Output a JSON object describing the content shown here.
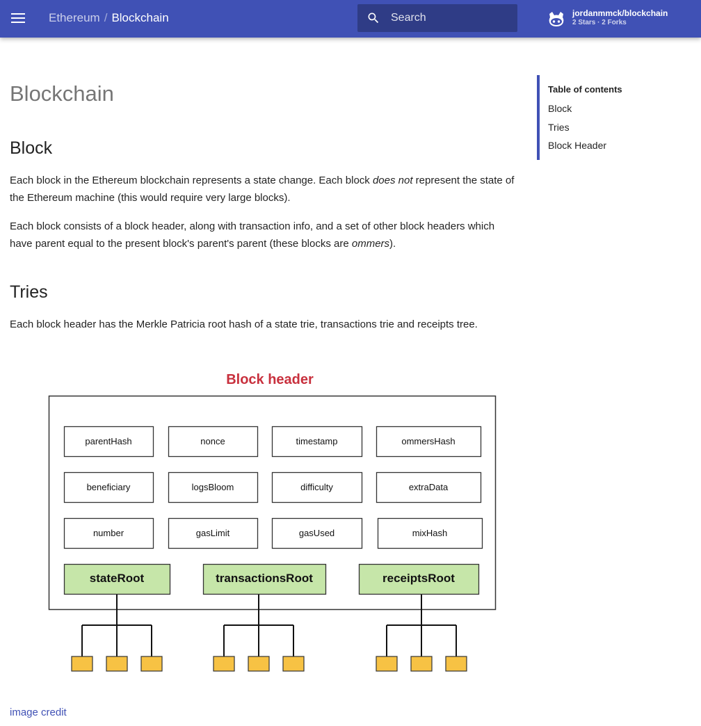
{
  "header": {
    "site_name": "Ethereum",
    "separator": "/",
    "page_name": "Blockchain",
    "search_placeholder": "Search",
    "repo_name": "jordanmmck/blockchain",
    "repo_facts": "2 Stars · 2 Forks"
  },
  "page": {
    "title": "Blockchain",
    "block_heading": "Block",
    "p1_a": "Each block in the Ethereum blockchain represents a state change. Each block ",
    "p1_em": "does not",
    "p1_b": " represent the state of the Ethereum machine (this would require very large blocks).",
    "p2_a": "Each block consists of a block header, along with transaction info, and a set of other block headers which have parent equal to the present block's parent's parent (these blocks are ",
    "p2_em": "ommers",
    "p2_b": ").",
    "tries_heading": "Tries",
    "p3": "Each block header has the Merkle Patricia root hash of a state trie, transactions trie and receipts tree.",
    "image_credit": "image credit"
  },
  "toc": {
    "title": "Table of contents",
    "items": [
      "Block",
      "Tries",
      "Block Header"
    ]
  },
  "diagram": {
    "title": "Block header",
    "title_color": "#c8303d",
    "fields": [
      [
        "parentHash",
        "nonce",
        "timestamp",
        "ommersHash"
      ],
      [
        "beneficiary",
        "logsBloom",
        "difficulty",
        "extraData"
      ],
      [
        "number",
        "gasLimit",
        "gasUsed",
        "mixHash"
      ]
    ],
    "roots": [
      "stateRoot",
      "transactionsRoot",
      "receiptsRoot"
    ],
    "root_fill": "#c6e6a9",
    "leaf_fill": "#f7c244"
  },
  "colors": {
    "primary": "#4051b5",
    "link": "#4051b5"
  }
}
